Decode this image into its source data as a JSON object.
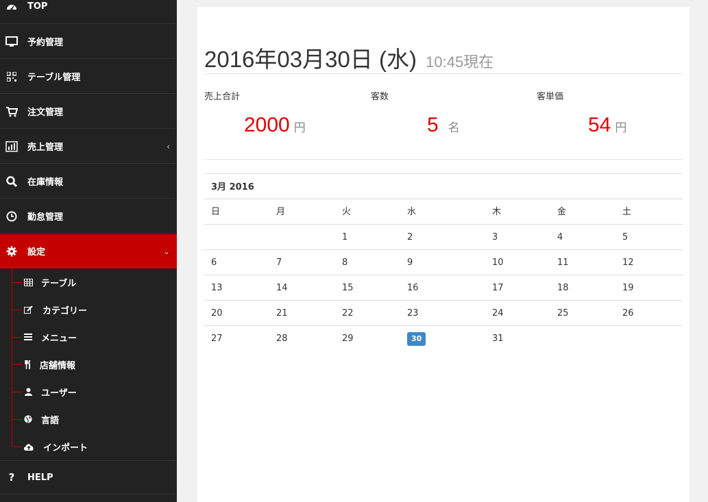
{
  "sidebar": {
    "items": [
      {
        "label": "TOP",
        "icon": "dashboard-icon"
      },
      {
        "label": "予約管理",
        "icon": "monitor-icon"
      },
      {
        "label": "テーブル管理",
        "icon": "qrcode-icon"
      },
      {
        "label": "注文管理",
        "icon": "cart-icon"
      },
      {
        "label": "売上管理",
        "icon": "bar-chart-icon",
        "chevron": "‹"
      },
      {
        "label": "在庫情報",
        "icon": "search-icon"
      },
      {
        "label": "勤怠管理",
        "icon": "clock-icon"
      },
      {
        "label": "設定",
        "icon": "gear-icon",
        "chevron": "⌄",
        "active": true
      },
      {
        "label": "HELP",
        "icon": "question-icon"
      }
    ],
    "settings_sub": [
      {
        "label": "テーブル",
        "icon": "table-icon"
      },
      {
        "label": "カテゴリー",
        "icon": "edit-icon"
      },
      {
        "label": "メニュー",
        "icon": "list-icon"
      },
      {
        "label": "店舗情報",
        "icon": "cutlery-icon"
      },
      {
        "label": "ユーザー",
        "icon": "user-icon"
      },
      {
        "label": "言語",
        "icon": "globe-icon"
      },
      {
        "label": "インポート",
        "icon": "cloud-upload-icon"
      }
    ],
    "accent_color": "#c40000"
  },
  "header": {
    "date": "2016年03月30日 (水)",
    "time": "10:45現在"
  },
  "stats": [
    {
      "label": "売上合計",
      "value": "2000",
      "unit": "円"
    },
    {
      "label": "客数",
      "value": "5",
      "unit": "名"
    },
    {
      "label": "客単価",
      "value": "54",
      "unit": "円"
    }
  ],
  "calendar": {
    "title": "3月 2016",
    "weekdays": [
      "日",
      "月",
      "火",
      "水",
      "木",
      "金",
      "土"
    ],
    "weeks": [
      [
        "",
        "",
        "1",
        "2",
        "3",
        "4",
        "5"
      ],
      [
        "6",
        "7",
        "8",
        "9",
        "10",
        "11",
        "12"
      ],
      [
        "13",
        "14",
        "15",
        "16",
        "17",
        "18",
        "19"
      ],
      [
        "20",
        "21",
        "22",
        "23",
        "24",
        "25",
        "26"
      ],
      [
        "27",
        "28",
        "29",
        "30",
        "31",
        "",
        ""
      ]
    ],
    "today": "30",
    "today_color": "#3f87c7"
  }
}
